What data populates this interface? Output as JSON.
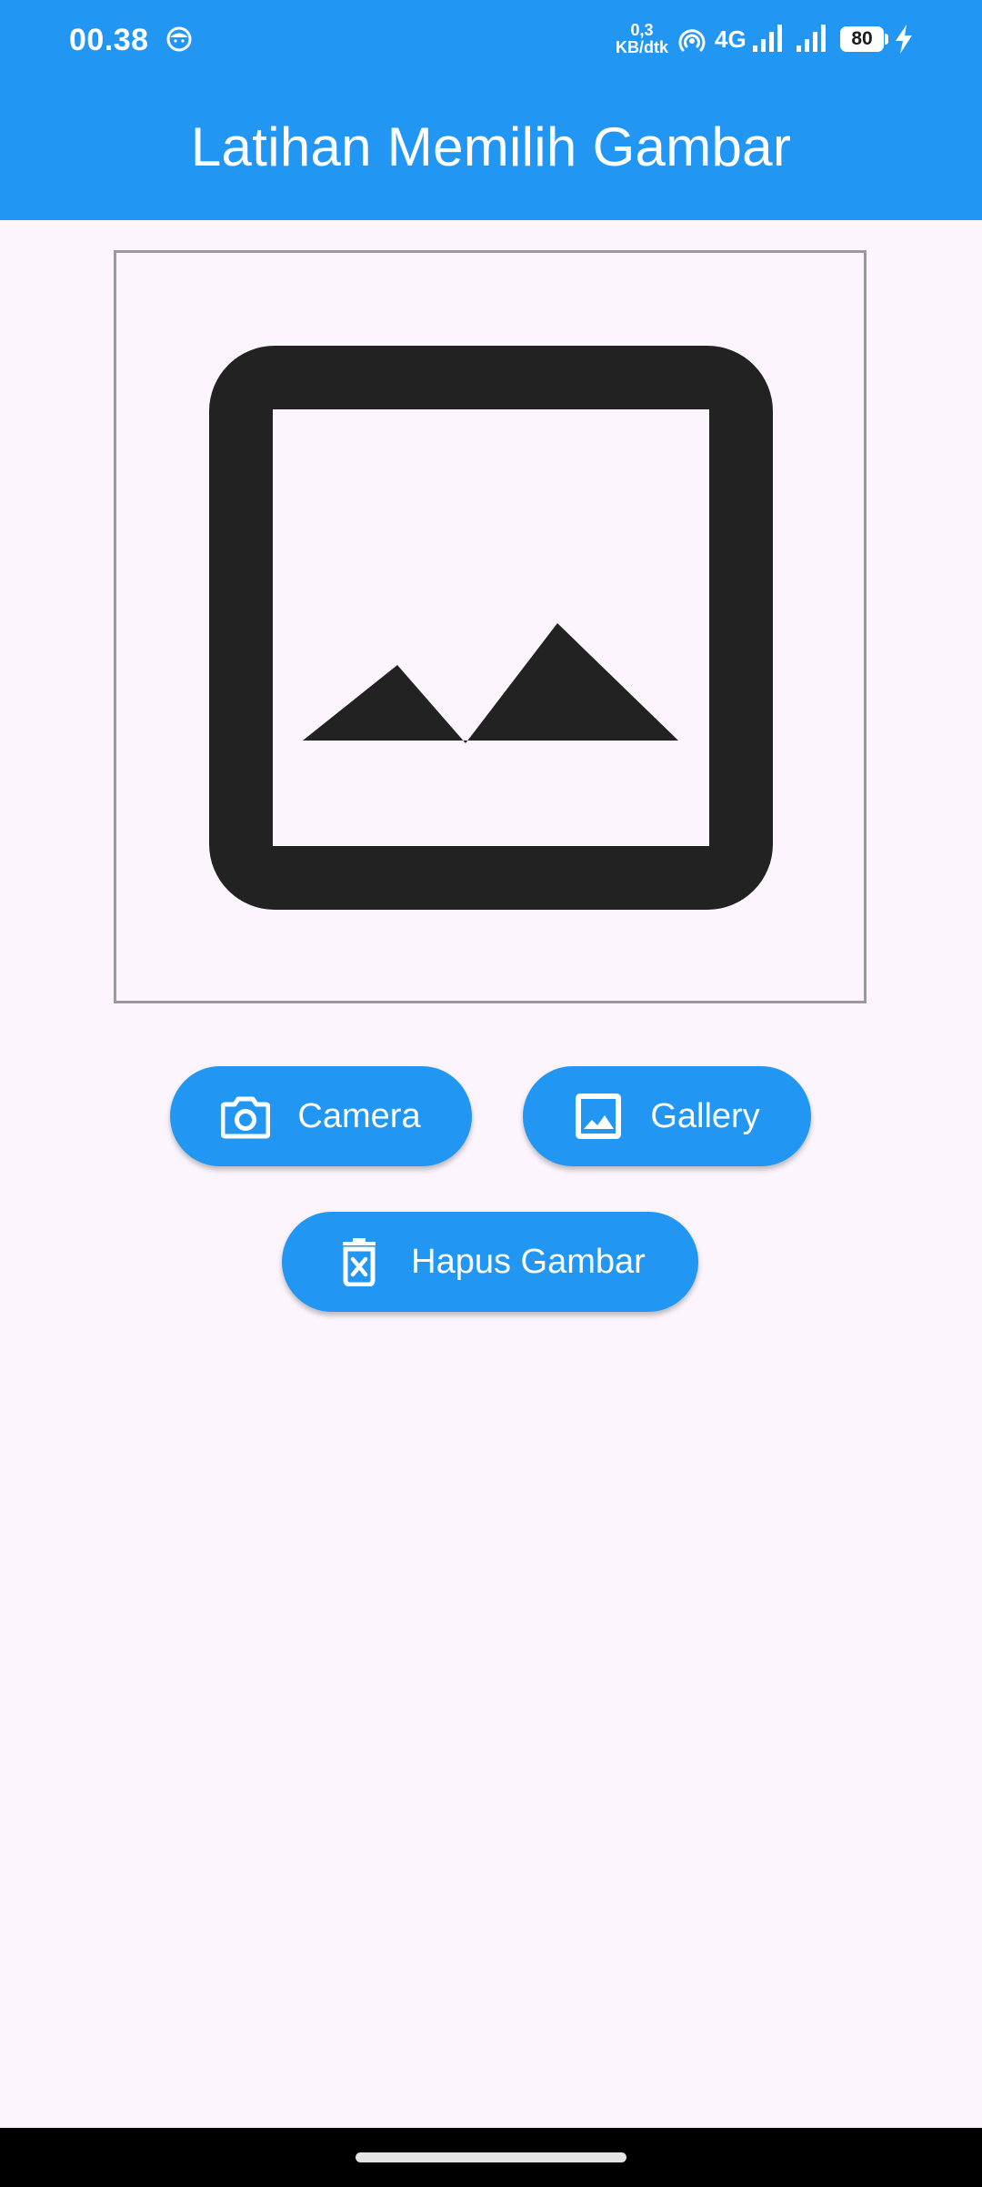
{
  "status_bar": {
    "time": "00.38",
    "speed_value": "0,3",
    "speed_unit": "KB/dtk",
    "network": "4G",
    "battery": "80",
    "icons": [
      "face-icon",
      "hotspot-icon",
      "signal-icon",
      "signal-icon",
      "battery-icon",
      "charging-bolt-icon"
    ]
  },
  "app_bar": {
    "title": "Latihan Memilih Gambar"
  },
  "preview": {
    "icon": "image-placeholder-icon"
  },
  "buttons": {
    "camera": {
      "label": "Camera",
      "icon": "camera-icon"
    },
    "gallery": {
      "label": "Gallery",
      "icon": "gallery-icon"
    },
    "delete": {
      "label": "Hapus Gambar",
      "icon": "delete-forever-icon"
    }
  },
  "colors": {
    "primary": "#2196f3",
    "background": "#fcf5fd",
    "icon_dark": "#222222",
    "frame_border": "#9a9a9a"
  }
}
